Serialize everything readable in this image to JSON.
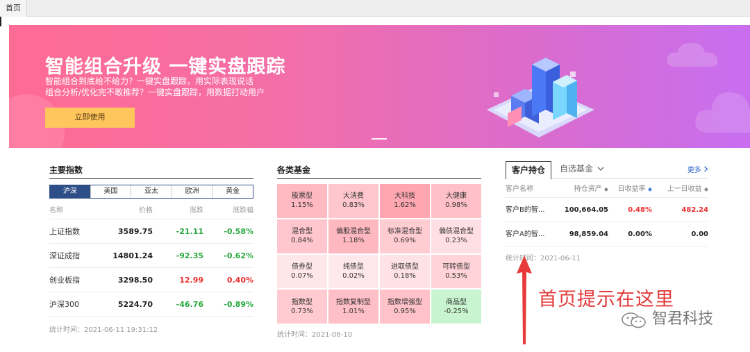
{
  "tabbar": {
    "home_tab": "首页"
  },
  "banner": {
    "title": "智能组合升级 一键实盘跟踪",
    "subtitle_line1": "智能组合到底给不给力？一键实盘跟踪，用实际表现说话",
    "subtitle_line2": "组合分析/优化完不敢推荐？一键实盘跟踪，用数据打动用户",
    "cta_label": "立即使用"
  },
  "indices": {
    "title": "主要指数",
    "segments": [
      "沪深",
      "美国",
      "亚太",
      "欧洲",
      "黄金"
    ],
    "active_segment": "沪深",
    "columns": [
      "名称",
      "价格",
      "涨跌",
      "涨跌幅"
    ],
    "rows": [
      {
        "name": "上证指数",
        "price": "3589.75",
        "change": "-21.11",
        "pct": "-0.58%"
      },
      {
        "name": "深证成指",
        "price": "14801.24",
        "change": "-92.35",
        "pct": "-0.62%"
      },
      {
        "name": "创业板指",
        "price": "3298.50",
        "change": "12.99",
        "pct": "0.40%"
      },
      {
        "name": "沪深300",
        "price": "5224.70",
        "change": "-46.76",
        "pct": "-0.89%"
      }
    ],
    "timestamp": "统计时间：2021-06-11 19:31:12"
  },
  "funds": {
    "title": "各类基金",
    "cells": [
      {
        "name": "股票型",
        "value": "1.15%"
      },
      {
        "name": "大消费",
        "value": "0.83%"
      },
      {
        "name": "大科技",
        "value": "1.62%"
      },
      {
        "name": "大健康",
        "value": "0.98%"
      },
      {
        "name": "混合型",
        "value": "0.84%"
      },
      {
        "name": "偏股混合型",
        "value": "1.18%"
      },
      {
        "name": "标准混合型",
        "value": "0.69%"
      },
      {
        "name": "偏债混合型",
        "value": "0.23%"
      },
      {
        "name": "债券型",
        "value": "0.07%"
      },
      {
        "name": "纯债型",
        "value": "0.02%"
      },
      {
        "name": "进取债型",
        "value": "0.18%"
      },
      {
        "name": "可转债型",
        "value": "0.53%"
      },
      {
        "name": "指数型",
        "value": "0.73%"
      },
      {
        "name": "指数复制型",
        "value": "1.01%"
      },
      {
        "name": "指数增强型",
        "value": "0.95%"
      },
      {
        "name": "商品型",
        "value": "-0.25%"
      }
    ],
    "timestamp": "统计时间：2021-06-10"
  },
  "holdings": {
    "tab_active": "客户持仓",
    "tab_inactive": "自选基金",
    "more_label": "更多",
    "columns": [
      "客户名称",
      "持仓资产",
      "日收益率",
      "上一日收益"
    ],
    "rows": [
      {
        "name": "客户B的智...",
        "assets": "100,664.05",
        "daily_return": "0.48%",
        "prev_income": "482.24"
      },
      {
        "name": "客户A的智...",
        "assets": "98,859.04",
        "daily_return": "0.00%",
        "prev_income": "0.00"
      }
    ],
    "timestamp": "统计时间：2021-06-11"
  },
  "annotation": {
    "text": "首页提示在这里"
  },
  "watermark": {
    "text": "智君科技"
  },
  "colors": {
    "up": "#e8302f",
    "down": "#27a83f",
    "neutral": "#222222",
    "active_tab": "#2d4e86",
    "cta": "#ffc65e",
    "link": "#2b63c6"
  }
}
